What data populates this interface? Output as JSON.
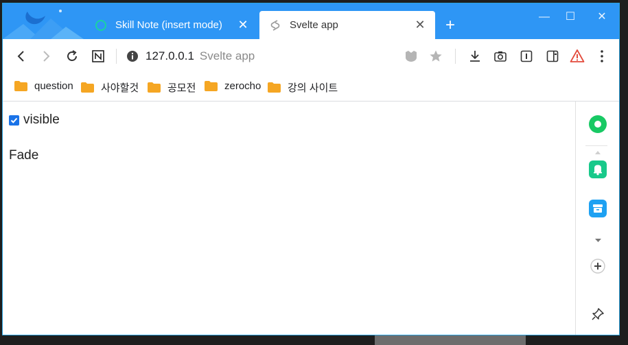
{
  "tabs": [
    {
      "title": "Skill Note (insert mode)",
      "active": false,
      "icon": "circle-outline-icon"
    },
    {
      "title": "Svelte app",
      "active": true,
      "icon": "svelte-icon"
    }
  ],
  "toolbar": {
    "url_host": "127.0.0.1",
    "url_title": "Svelte app"
  },
  "bookmarks": [
    {
      "label": "question"
    },
    {
      "label": "사야할것"
    },
    {
      "label": "공모전"
    },
    {
      "label": "zerocho"
    },
    {
      "label": "강의 사이트"
    }
  ],
  "content": {
    "checkbox_label": "visible",
    "checkbox_checked": true,
    "fade_text": "Fade"
  },
  "colors": {
    "titlebar": "#2e96f5",
    "accent_green": "#18c964",
    "accent_blue": "#1ea1f2",
    "checkbox": "#1a73e8"
  }
}
